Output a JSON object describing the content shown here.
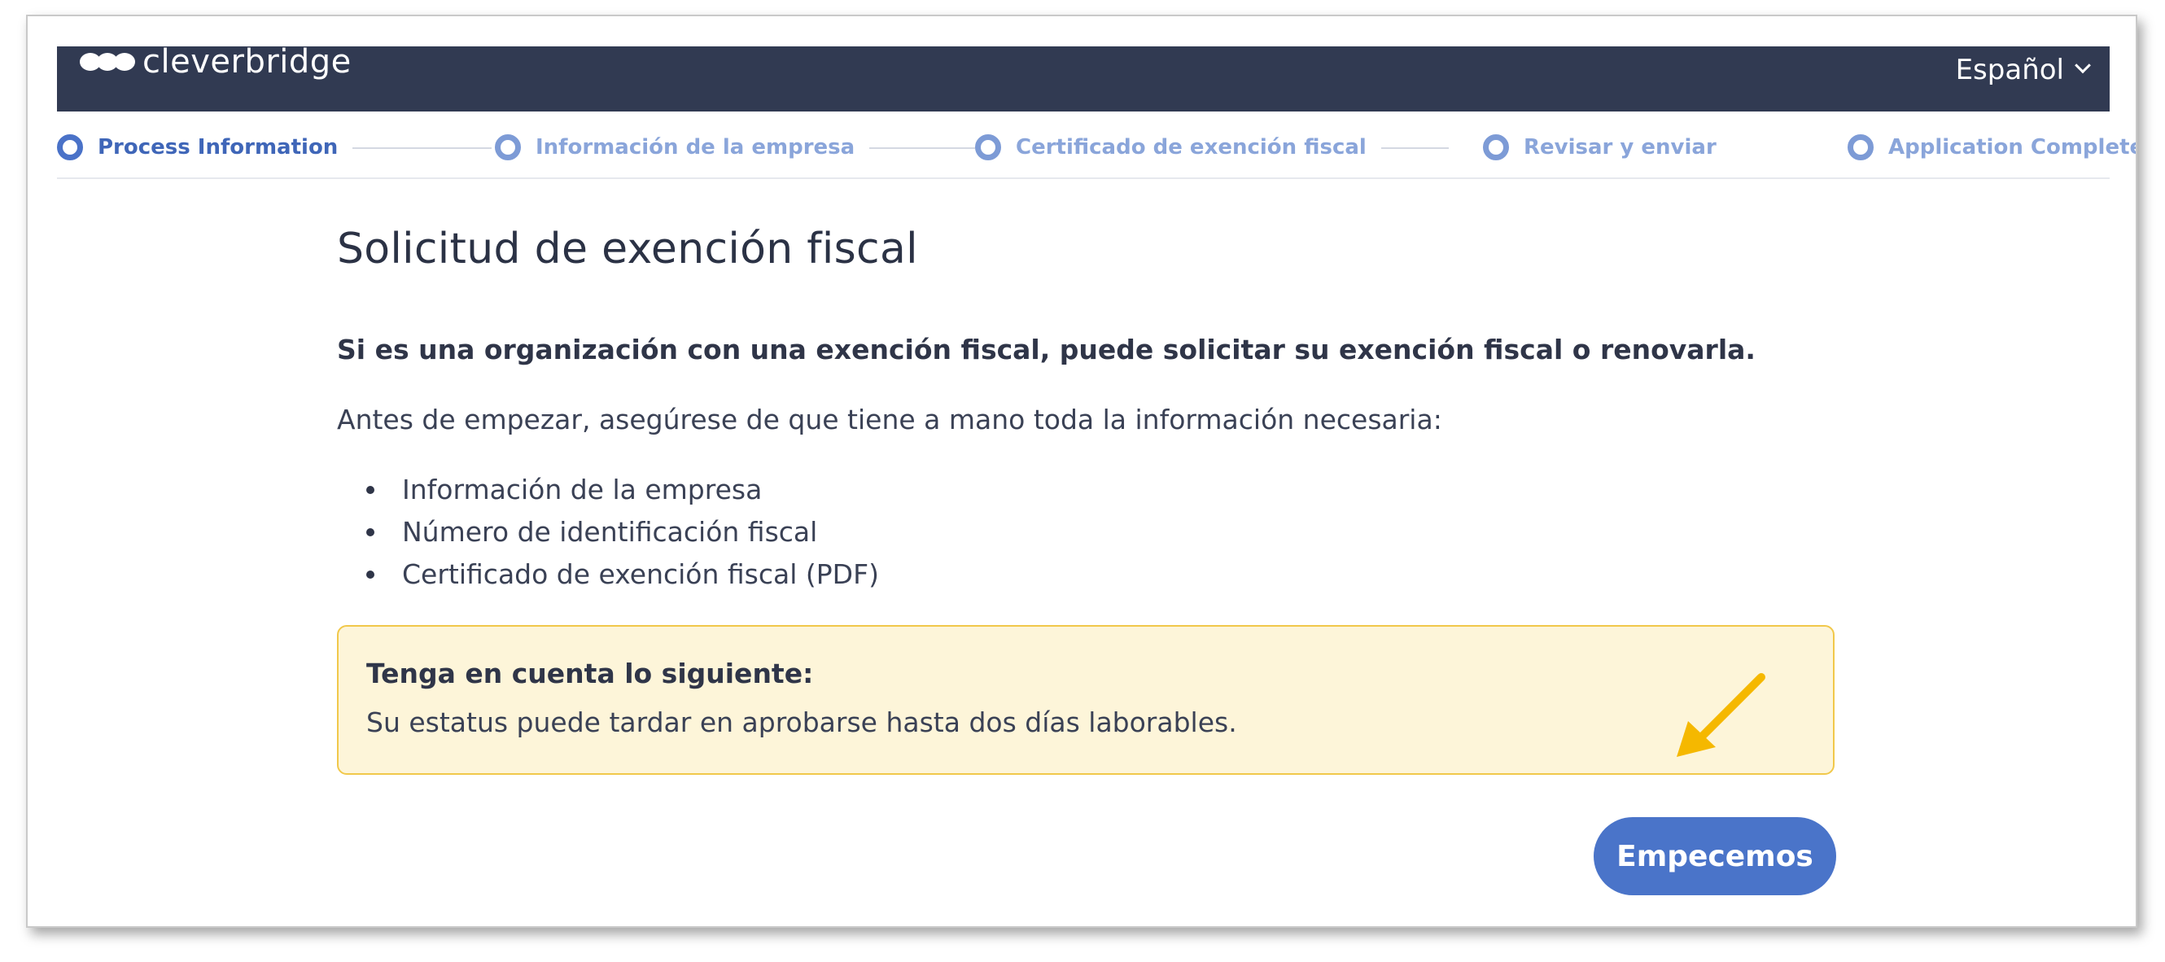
{
  "header": {
    "brand": "cleverbridge",
    "language": "Español",
    "background_color": "#313a52"
  },
  "stepper": {
    "steps": [
      {
        "label": "Process Information",
        "active": true
      },
      {
        "label": "Información de la empresa",
        "active": false
      },
      {
        "label": "Certificado de exención fiscal",
        "active": false
      },
      {
        "label": "Revisar y enviar",
        "active": false
      },
      {
        "label": "Application Completed",
        "active": false
      }
    ],
    "accent_color": "#4a72c8"
  },
  "main": {
    "title": "Solicitud de exención fiscal",
    "intro": "Si es una organización con una exención fiscal, puede solicitar su exención fiscal o renovarla.",
    "before_text": "Antes de empezar, asegúrese de que tiene a mano toda la información necesaria:",
    "requirements": [
      "Información de la empresa",
      "Número de identificación fiscal",
      "Certificado de exención fiscal (PDF)"
    ]
  },
  "notice": {
    "title": "Tenga en cuenta lo siguiente:",
    "text": "Su estatus puede tardar en aprobarse hasta dos días laborables.",
    "background_color": "#fdf5d9",
    "border_color": "#f1c84a",
    "annotation": "arrow-icon",
    "annotation_color": "#f5b800"
  },
  "actions": {
    "start_label": "Empecemos",
    "button_color": "#4a74c9"
  }
}
